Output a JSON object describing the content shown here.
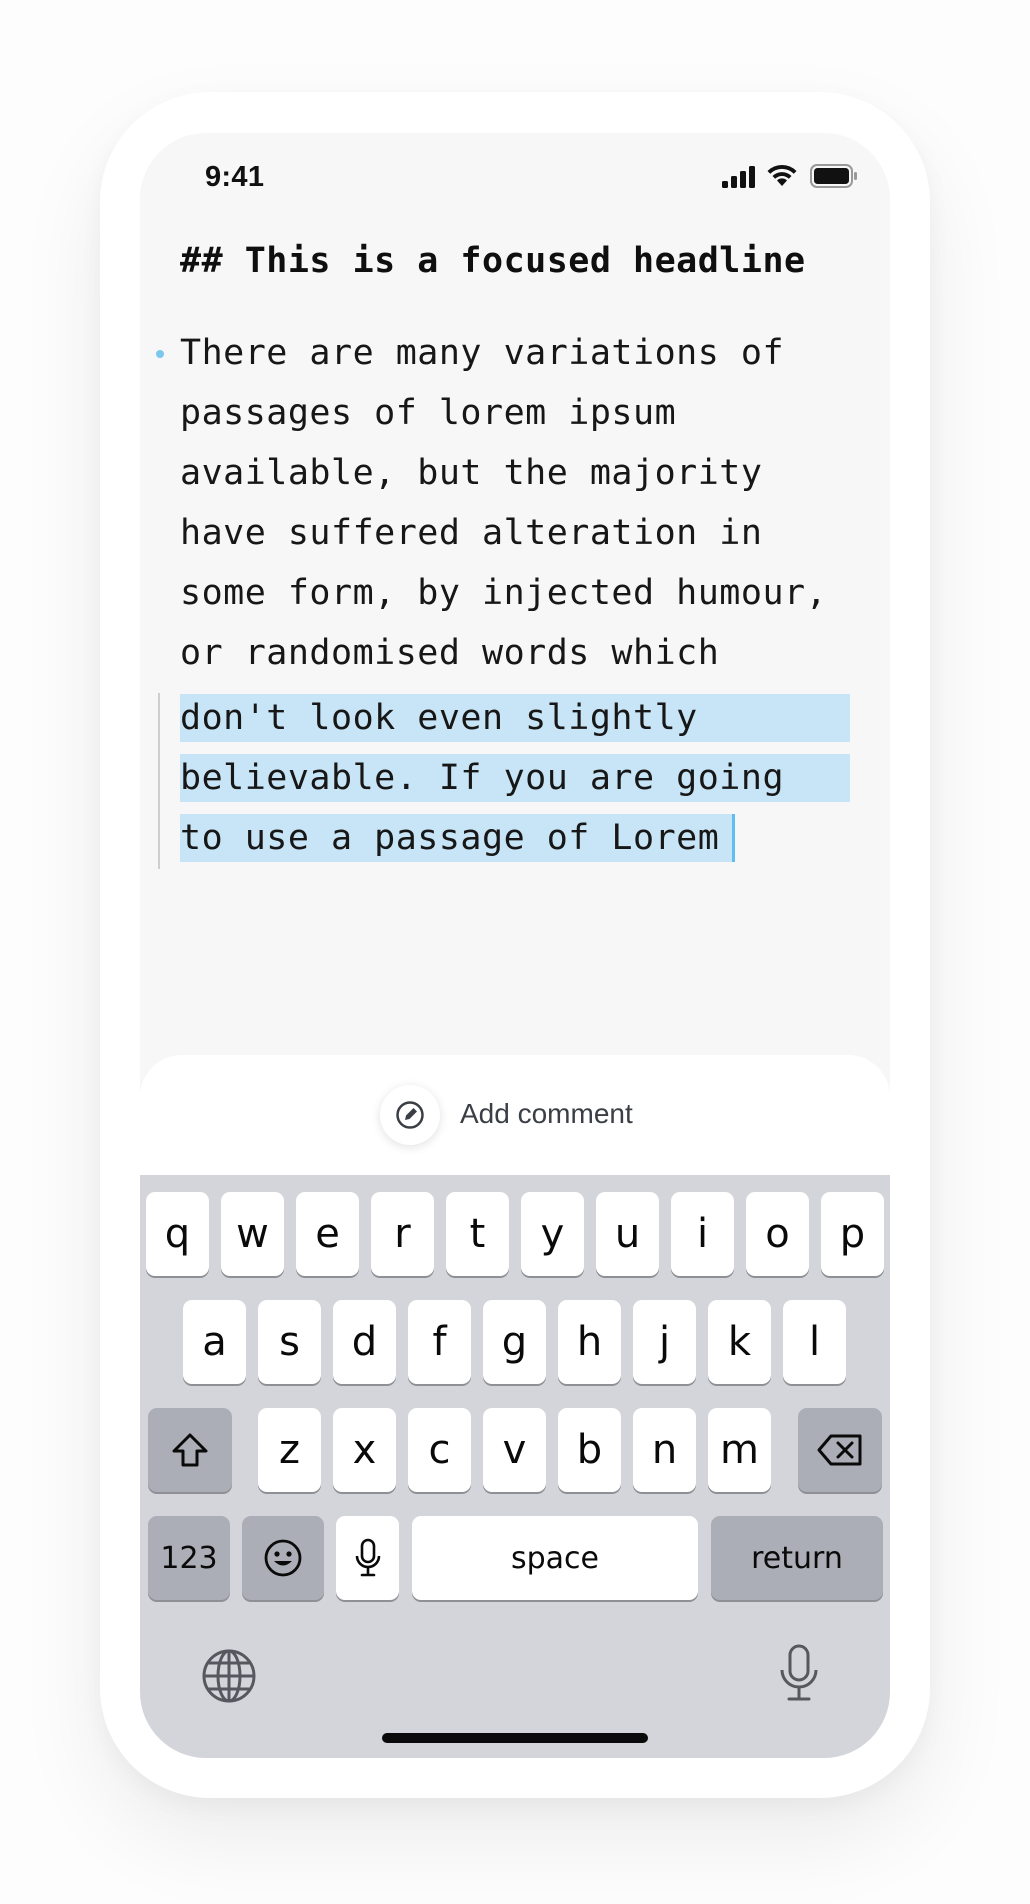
{
  "status_bar": {
    "time": "9:41"
  },
  "editor": {
    "headline": "## This is a focused headline",
    "paragraph_lines": [
      "There are many variations of",
      "passages of lorem ipsum",
      "available, but the majority",
      "have suffered alteration in",
      "some form, by injected humour,",
      "or randomised words which"
    ],
    "selected_lines": [
      "don't look even slightly",
      "believable. If you are going",
      "to use a passage of Lorem"
    ]
  },
  "comment_bar": {
    "label": "Add comment",
    "icon": "pen-circle-icon"
  },
  "keyboard": {
    "row1": [
      "q",
      "w",
      "e",
      "r",
      "t",
      "y",
      "u",
      "i",
      "o",
      "p"
    ],
    "row2": [
      "a",
      "s",
      "d",
      "f",
      "g",
      "h",
      "j",
      "k",
      "l"
    ],
    "row3": [
      "z",
      "x",
      "c",
      "v",
      "b",
      "n",
      "m"
    ],
    "numbers_label": "123",
    "space_label": "space",
    "return_label": "return",
    "icons": [
      "shift-icon",
      "delete-icon",
      "emoji-icon",
      "microphone-icon",
      "globe-icon",
      "dictation-icon"
    ]
  },
  "colors": {
    "selection": "#c7e5f6",
    "caret": "#62bdf0",
    "bullet": "#7cc7ee",
    "keyboard_bg": "#d4d5da",
    "dark_key": "#abaeb6"
  }
}
